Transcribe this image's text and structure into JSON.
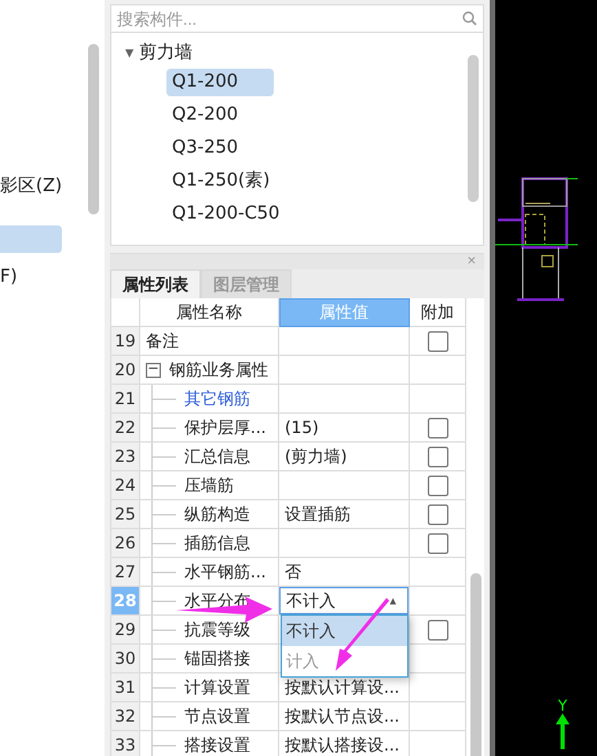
{
  "left_panel": {
    "items": [
      {
        "label": "影区(Z)",
        "selected": false
      },
      {
        "label": "F)",
        "selected": false
      }
    ],
    "highlight": true
  },
  "component_tree": {
    "search": {
      "placeholder": "搜索构件..."
    },
    "groups": [
      {
        "label": "剪力墙",
        "caret": "▼",
        "expanded": true,
        "children": [
          {
            "label": "Q1-200",
            "selected": true
          },
          {
            "label": "Q2-200",
            "selected": false
          },
          {
            "label": "Q3-250",
            "selected": false
          },
          {
            "label": "Q1-250(素)",
            "selected": false
          },
          {
            "label": "Q1-200-C50",
            "selected": false
          }
        ]
      }
    ]
  },
  "property_panel": {
    "close": "×",
    "tabs": [
      {
        "label": "属性列表",
        "selected": true
      },
      {
        "label": "图层管理",
        "selected": false
      }
    ],
    "columns": [
      {
        "label": "属性名称",
        "selected": false
      },
      {
        "label": "属性值",
        "selected": true
      },
      {
        "label": "附加",
        "selected": false
      }
    ],
    "rows": [
      {
        "num": "19",
        "kind": "item",
        "name": "备注",
        "value": "",
        "checked": false,
        "selected": false
      },
      {
        "num": "20",
        "kind": "group",
        "name": "钢筋业务属性",
        "toggle": "−",
        "expanded": true,
        "value": "",
        "selected": false
      },
      {
        "num": "21",
        "kind": "category",
        "name": "其它钢筋",
        "value": "",
        "selected": false
      },
      {
        "num": "22",
        "kind": "child",
        "name": "保护层厚...",
        "value": "(15)",
        "checked": false,
        "selected": false
      },
      {
        "num": "23",
        "kind": "child",
        "name": "汇总信息",
        "value": "(剪力墙)",
        "checked": false,
        "selected": false
      },
      {
        "num": "24",
        "kind": "child",
        "name": "压墙筋",
        "value": "",
        "checked": false,
        "selected": false
      },
      {
        "num": "25",
        "kind": "child",
        "name": "纵筋构造",
        "value": "设置插筋",
        "checked": false,
        "selected": false
      },
      {
        "num": "26",
        "kind": "child",
        "name": "插筋信息",
        "value": "",
        "checked": false,
        "selected": false
      },
      {
        "num": "27",
        "kind": "child",
        "name": "水平钢筋...",
        "value": "否",
        "selected": false
      },
      {
        "num": "28",
        "kind": "child",
        "name": "水平分布",
        "value": "不计入",
        "selected": true,
        "dropdown": {
          "caret": "▲",
          "options": [
            {
              "label": "不计入",
              "selected": true
            },
            {
              "label": "计入",
              "selected": false
            }
          ]
        }
      },
      {
        "num": "29",
        "kind": "child",
        "name": "抗震等级",
        "value": "",
        "checked": false,
        "selected": false
      },
      {
        "num": "30",
        "kind": "child",
        "name": "锚固搭接",
        "value": "",
        "selected": false
      },
      {
        "num": "31",
        "kind": "child",
        "name": "计算设置",
        "value": "按默认计算设...",
        "selected": false
      },
      {
        "num": "32",
        "kind": "child",
        "name": "节点设置",
        "value": "按默认节点设...",
        "selected": false
      },
      {
        "num": "33",
        "kind": "child",
        "name": "搭接设置",
        "value": "按默认搭接设...",
        "selected": false
      }
    ]
  },
  "canvas": {
    "axis_label": "Y"
  }
}
